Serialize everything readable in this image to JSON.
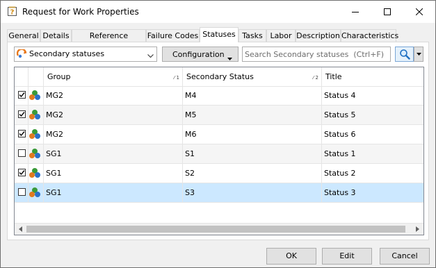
{
  "window": {
    "title": "Request for Work Properties"
  },
  "tabs": [
    {
      "label": "General",
      "active": false
    },
    {
      "label": "Details",
      "active": false
    },
    {
      "label": "Reference Numbers",
      "active": false
    },
    {
      "label": "Failure Codes",
      "active": false
    },
    {
      "label": "Statuses",
      "active": true
    },
    {
      "label": "Tasks",
      "active": false
    },
    {
      "label": "Labor",
      "active": false
    },
    {
      "label": "Description",
      "active": false
    },
    {
      "label": "Characteristics",
      "active": false
    }
  ],
  "toolbar": {
    "view_selected": "Secondary statuses",
    "configuration_label": "Configuration",
    "search_placeholder": "Search Secondary statuses  (Ctrl+F)"
  },
  "grid": {
    "columns": [
      {
        "label": "Group",
        "sort": "1"
      },
      {
        "label": "Secondary Status",
        "sort": "2"
      },
      {
        "label": "Title",
        "sort": ""
      }
    ],
    "rows": [
      {
        "checked": true,
        "group": "MG2",
        "status": "M4",
        "title": "Status 4",
        "selected": false
      },
      {
        "checked": true,
        "group": "MG2",
        "status": "M5",
        "title": "Status 5",
        "selected": false
      },
      {
        "checked": true,
        "group": "MG2",
        "status": "M6",
        "title": "Status 6",
        "selected": false
      },
      {
        "checked": false,
        "group": "SG1",
        "status": "S1",
        "title": "Status 1",
        "selected": false
      },
      {
        "checked": true,
        "group": "SG1",
        "status": "S2",
        "title": "Status 2",
        "selected": false
      },
      {
        "checked": false,
        "group": "SG1",
        "status": "S3",
        "title": "Status 3",
        "selected": true
      }
    ]
  },
  "buttons": {
    "ok": "OK",
    "edit": "Edit",
    "cancel": "Cancel"
  },
  "colors": {
    "selected_row": "#cce8ff",
    "alt_row": "#f5f5f5"
  }
}
